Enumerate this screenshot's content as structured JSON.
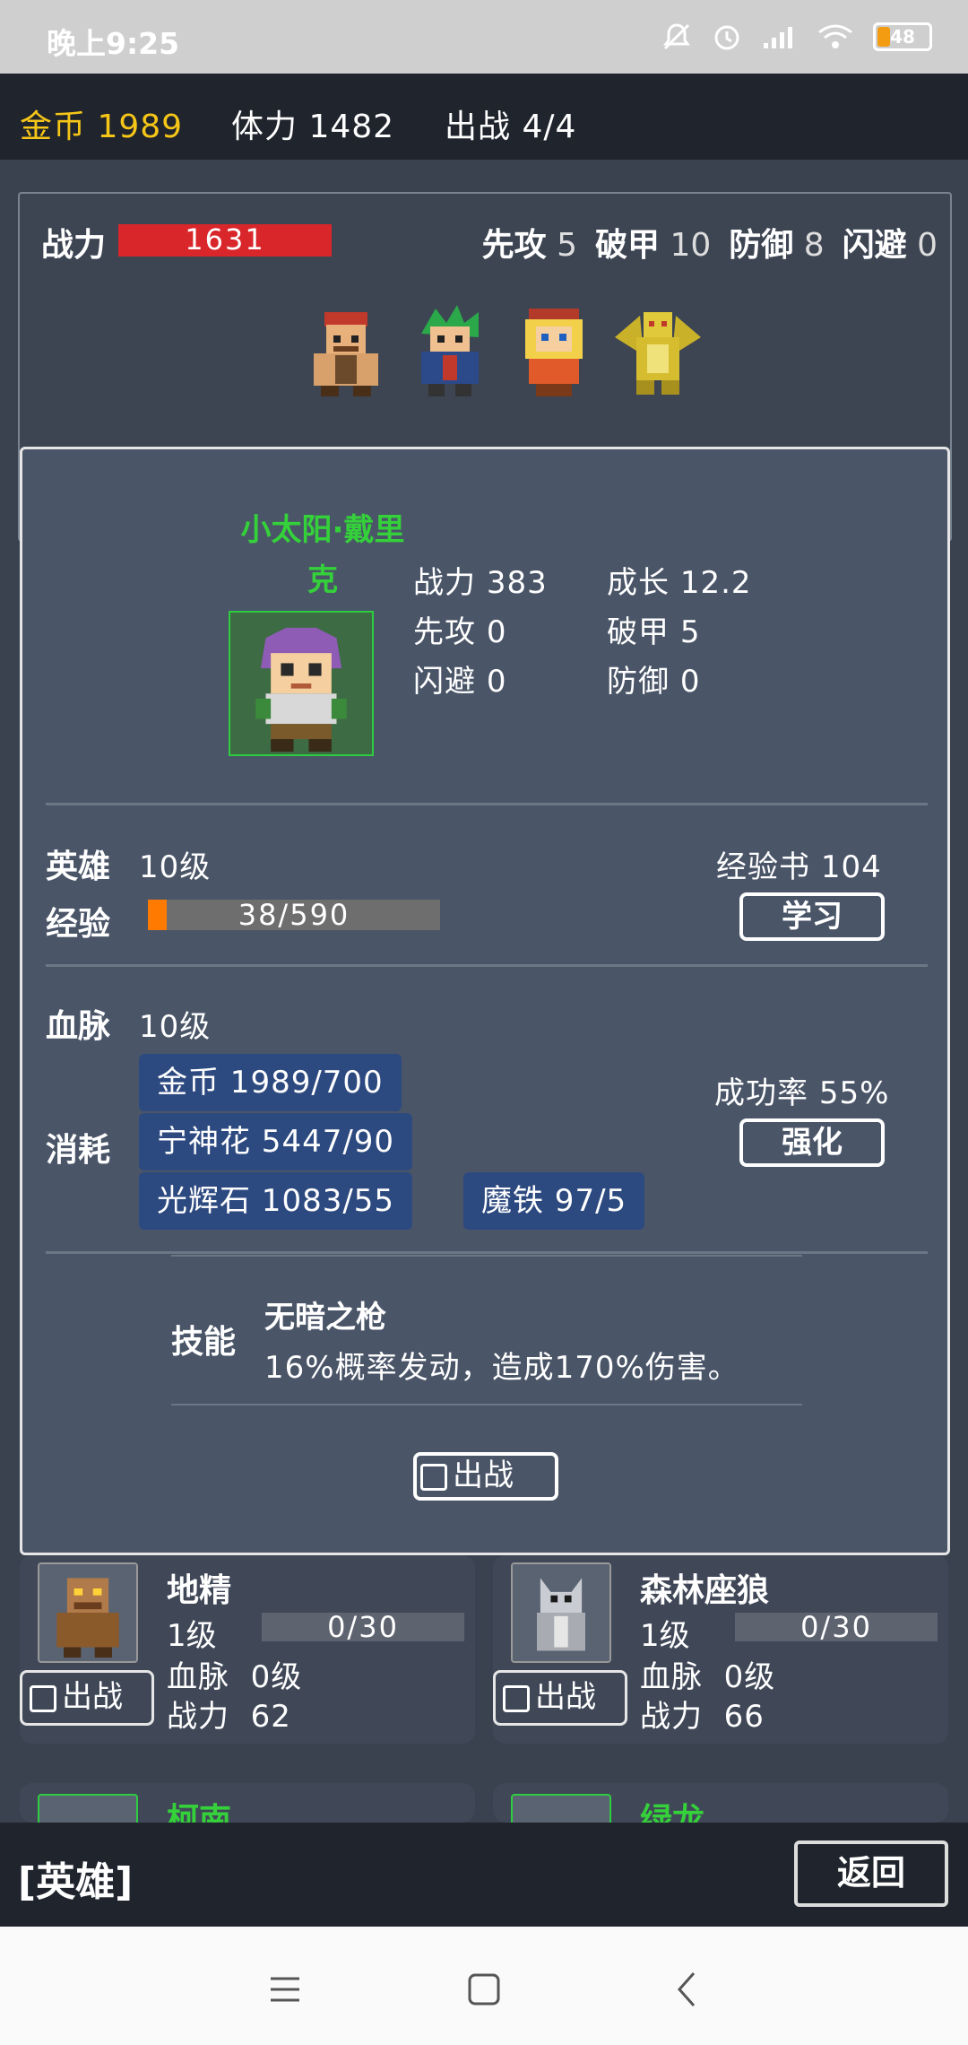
{
  "status_bar": {
    "time": "晚上9:25",
    "battery": "48",
    "icons": [
      "bell-off-icon",
      "alarm-icon",
      "signal-icon",
      "wifi-icon",
      "battery-icon"
    ]
  },
  "resources": {
    "gold_label": "金币",
    "gold_value": "1989",
    "stamina_label": "体力",
    "stamina_value": "1482",
    "deploy_label": "出战",
    "deploy_value": "4/4",
    "gold_color": "#f5c518"
  },
  "team": {
    "cp_label": "战力",
    "cp_value": "1631",
    "stats": [
      {
        "label": "先攻",
        "value": "5"
      },
      {
        "label": "破甲",
        "value": "10"
      },
      {
        "label": "防御",
        "value": "8"
      },
      {
        "label": "闪避",
        "value": "0"
      }
    ],
    "party": [
      "warrior-sprite",
      "green-hair-fighter-sprite",
      "blonde-girl-sprite",
      "golden-dragon-sprite"
    ]
  },
  "hero": {
    "name_line1": "小太阳·戴里",
    "name_line2": "克",
    "stats": {
      "cp_label": "战力",
      "cp": "383",
      "growth_label": "成长",
      "growth": "12.2",
      "first_label": "先攻",
      "first": "0",
      "pierce_label": "破甲",
      "pierce": "5",
      "dodge_label": "闪避",
      "dodge": "0",
      "defense_label": "防御",
      "defense": "0"
    },
    "level_label": "英雄",
    "level": "10级",
    "exp_label": "经验",
    "exp_text": "38/590",
    "exp_fraction": 0.064,
    "exp_book_label": "经验书",
    "exp_book": "104",
    "learn_button": "学习",
    "bloodline_label": "血脉",
    "bloodline_level": "10级",
    "consume_label": "消耗",
    "costs": [
      "金币 1989/700",
      "宁神花 5447/90",
      "光辉石 1083/55",
      "魔铁 97/5"
    ],
    "success_label": "成功率",
    "success_rate": "55%",
    "enhance_button": "强化",
    "skill_label": "技能",
    "skill_name": "无暗之枪",
    "skill_desc": "16%概率发动，造成170%伤害。",
    "deploy_checkbox": "出战"
  },
  "cards": [
    {
      "name": "地精",
      "level": "1级",
      "exp": "0/30",
      "bloodline_label": "血脉",
      "bloodline": "0级",
      "cp_label": "战力",
      "cp": "62",
      "deploy": "出战"
    },
    {
      "name": "森林座狼",
      "level": "1级",
      "exp": "0/30",
      "bloodline_label": "血脉",
      "bloodline": "0级",
      "cp_label": "战力",
      "cp": "66",
      "deploy": "出战"
    },
    {
      "name": "柯南"
    },
    {
      "name": "绿龙"
    }
  ],
  "footer": {
    "title": "[英雄]",
    "back_button": "返回"
  }
}
